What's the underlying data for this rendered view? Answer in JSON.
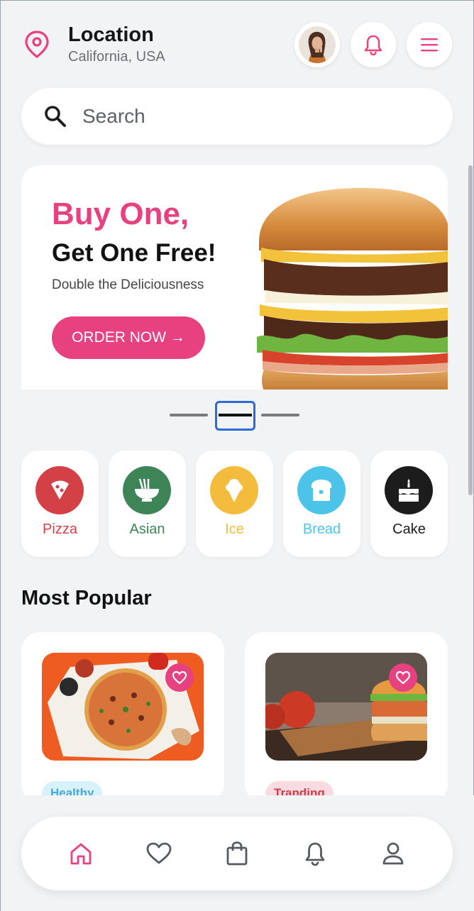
{
  "header": {
    "location_title": "Location",
    "location_value": "California, USA",
    "icons": [
      "location-pin-icon",
      "avatar",
      "bell-icon",
      "menu-icon"
    ]
  },
  "search": {
    "placeholder": "Search"
  },
  "banner": {
    "headline": "Buy One,",
    "subheadline": "Get One Free!",
    "tagline": "Double the Deliciousness",
    "cta": "ORDER NOW →"
  },
  "carousel": {
    "active_index": 1,
    "count": 3
  },
  "categories": [
    {
      "label": "Pizza",
      "color": "#d34146",
      "icon": "pizza-icon"
    },
    {
      "label": "Asian",
      "color": "#3d8456",
      "icon": "noodles-icon"
    },
    {
      "label": "Ice",
      "color": "#f4bc3c",
      "icon": "ice-cream-icon"
    },
    {
      "label": "Bread",
      "color": "#4cc4ea",
      "icon": "bread-icon"
    },
    {
      "label": "Cake",
      "color": "#1c1c1c",
      "icon": "cake-icon"
    }
  ],
  "popular": {
    "title": "Most Popular",
    "items": [
      {
        "tag": "Healthy",
        "tag_bg": "#d8f2fb",
        "tag_color": "#4aa9d8"
      },
      {
        "tag": "Tranding",
        "tag_bg": "#fadbe1",
        "tag_color": "#d23c4a"
      }
    ]
  },
  "colors": {
    "accent": "#e8417f"
  },
  "nav": {
    "items": [
      "home-icon",
      "heart-icon",
      "bag-icon",
      "bell-icon",
      "profile-icon"
    ],
    "active": "home-icon"
  }
}
